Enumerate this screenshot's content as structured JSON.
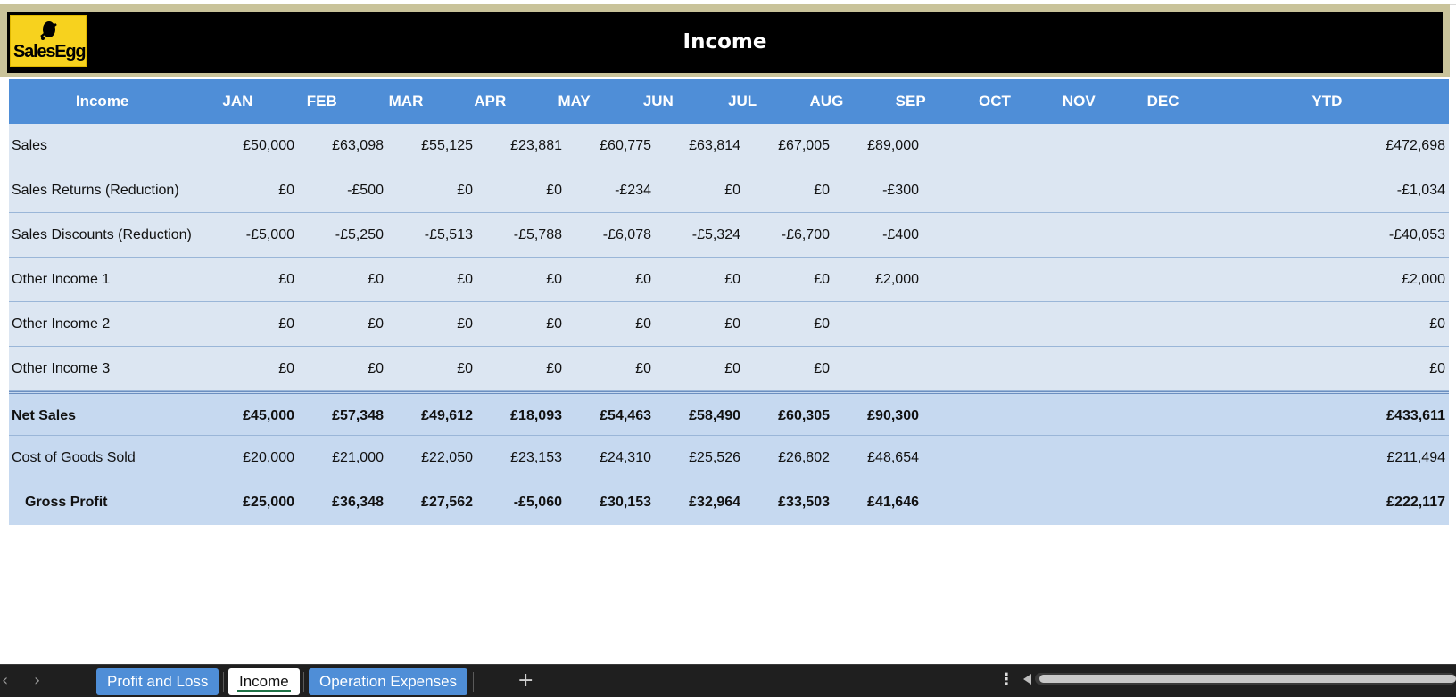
{
  "banner": {
    "logo_text": "SalesEgg",
    "title": "Income"
  },
  "table": {
    "headers": [
      "Income",
      "JAN",
      "FEB",
      "MAR",
      "APR",
      "MAY",
      "JUN",
      "JUL",
      "AUG",
      "SEP",
      "OCT",
      "NOV",
      "DEC",
      "YTD"
    ],
    "rows": [
      {
        "label": "Sales",
        "values": [
          "£50,000",
          "£63,098",
          "£55,125",
          "£23,881",
          "£60,775",
          "£63,814",
          "£67,005",
          "£89,000"
        ],
        "ytd": "£472,698"
      },
      {
        "label": "Sales Returns (Reduction)",
        "values": [
          "£0",
          "-£500",
          "£0",
          "£0",
          "-£234",
          "£0",
          "£0",
          "-£300"
        ],
        "ytd": "-£1,034"
      },
      {
        "label": "Sales Discounts (Reduction)",
        "values": [
          "-£5,000",
          "-£5,250",
          "-£5,513",
          "-£5,788",
          "-£6,078",
          "-£5,324",
          "-£6,700",
          "-£400"
        ],
        "ytd": "-£40,053"
      },
      {
        "label": "Other Income 1",
        "values": [
          "£0",
          "£0",
          "£0",
          "£0",
          "£0",
          "£0",
          "£0",
          "£2,000"
        ],
        "ytd": "£2,000"
      },
      {
        "label": "Other Income 2",
        "values": [
          "£0",
          "£0",
          "£0",
          "£0",
          "£0",
          "£0",
          "£0",
          ""
        ],
        "ytd": "£0"
      },
      {
        "label": "Other Income 3",
        "values": [
          "£0",
          "£0",
          "£0",
          "£0",
          "£0",
          "£0",
          "£0",
          ""
        ],
        "ytd": "£0"
      }
    ],
    "net_sales": {
      "label": "Net Sales",
      "values": [
        "£45,000",
        "£57,348",
        "£49,612",
        "£18,093",
        "£54,463",
        "£58,490",
        "£60,305",
        "£90,300"
      ],
      "ytd": "£433,611"
    },
    "cogs": {
      "label": "Cost of Goods Sold",
      "values": [
        "£20,000",
        "£21,000",
        "£22,050",
        "£23,153",
        "£24,310",
        "£25,526",
        "£26,802",
        "£48,654"
      ],
      "ytd": "£211,494"
    },
    "gross_profit": {
      "label": "Gross Profit",
      "values": [
        "£25,000",
        "£36,348",
        "£27,562",
        "-£5,060",
        "£30,153",
        "£32,964",
        "£33,503",
        "£41,646"
      ],
      "ytd": "£222,117"
    }
  },
  "tabs": {
    "items": [
      {
        "label": "Profit and Loss"
      },
      {
        "label": "Income"
      },
      {
        "label": "Operation Expenses"
      }
    ],
    "active": "Income",
    "add_symbol": "+",
    "more_symbol": "⋮",
    "prev_symbol": "‹",
    "next_symbol": "›"
  },
  "colors": {
    "header_blue": "#4f8ed7",
    "row_light": "#dce6f2",
    "row_total": "#c6d9f0",
    "banner_black": "#000000",
    "logo_yellow": "#f7d21e"
  }
}
